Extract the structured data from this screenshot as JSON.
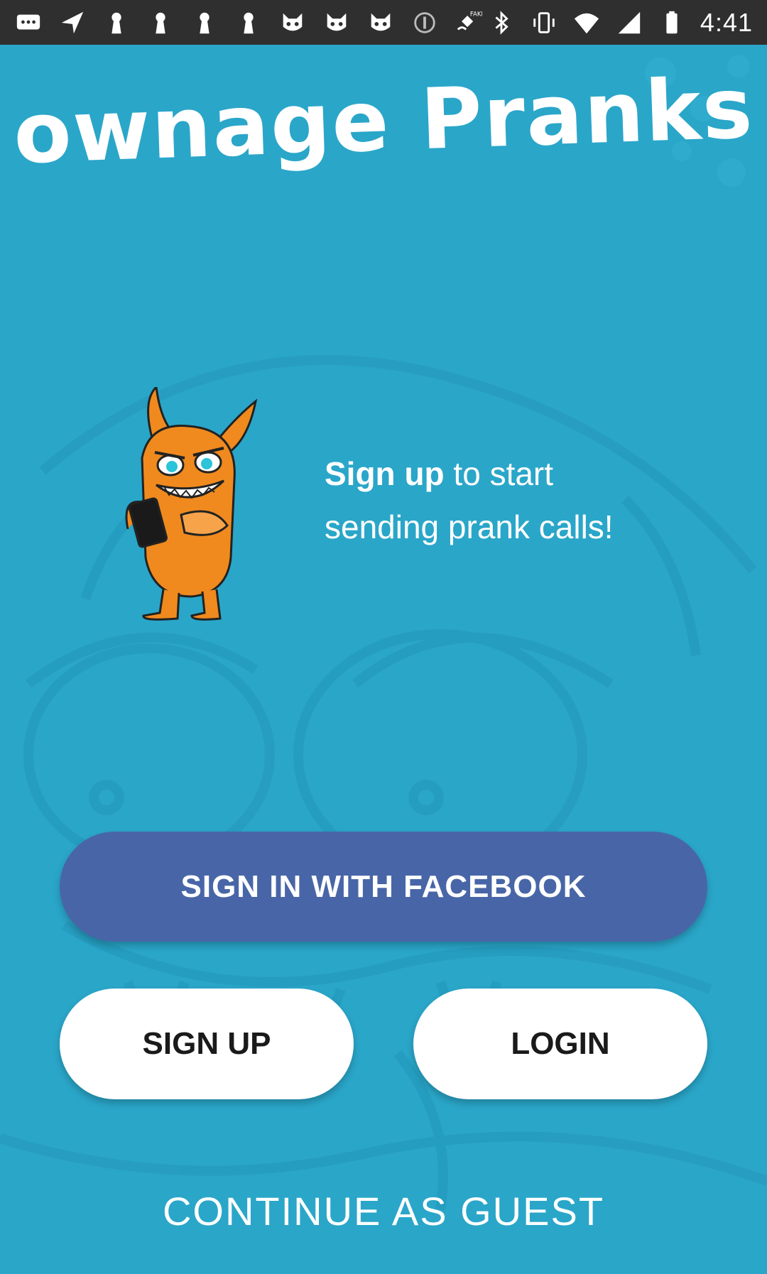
{
  "status_bar": {
    "time": "4:41",
    "left_icons": [
      "chat-bubble-icon",
      "navigation-icon",
      "keyhole-icon",
      "keyhole-icon",
      "keyhole-icon",
      "keyhole-icon",
      "cat-face-icon",
      "cat-face-icon",
      "cat-face-icon",
      "info-circle-icon",
      "fake-gps-icon"
    ],
    "right_icons": [
      "bluetooth-icon",
      "vibrate-icon",
      "wifi-icon",
      "cell-signal-icon",
      "battery-icon"
    ]
  },
  "colors": {
    "background": "#2AA6C9",
    "status_bar": "#2F2F2F",
    "facebook_button": "#4866A7",
    "white_button": "#FFFFFF",
    "mascot_orange": "#F08A1E"
  },
  "header": {
    "logo": "ownage Pranks"
  },
  "hero": {
    "mascot_icon": "orange-monster-mascot-icon",
    "tagline_bold": "Sign up",
    "tagline_rest_line1": " to start",
    "tagline_line2": "sending prank calls!"
  },
  "actions": {
    "facebook_label": "SIGN IN WITH FACEBOOK",
    "signup_label": "SIGN UP",
    "login_label": "LOGIN",
    "guest_label": "CONTINUE AS GUEST"
  }
}
